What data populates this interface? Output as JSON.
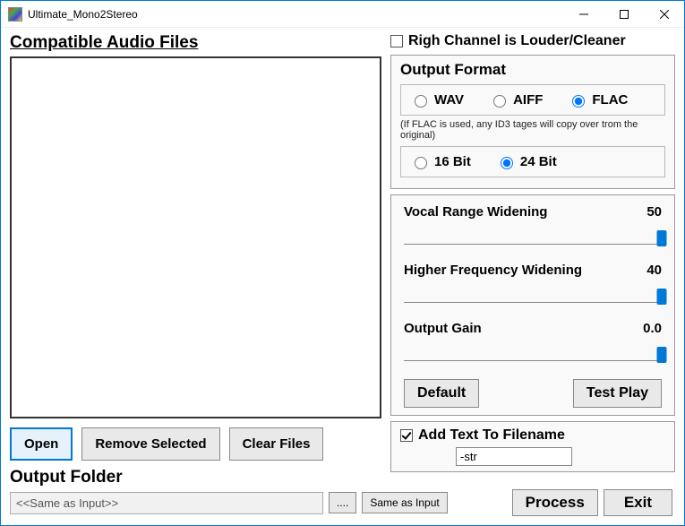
{
  "window": {
    "title": "Ultimate_Mono2Stereo"
  },
  "left": {
    "heading": "Compatible Audio Files",
    "open_btn": "Open",
    "remove_btn": "Remove Selected",
    "clear_btn": "Clear Files",
    "output_folder_label": "Output Folder",
    "output_folder_value": "<<Same as Input>>",
    "browse_btn": "....",
    "same_as_input_btn": "Same as Input"
  },
  "right": {
    "right_channel_label": "Righ Channel is Louder/Cleaner",
    "right_channel_checked": false,
    "output_format_title": "Output Format",
    "fmt_wav": "WAV",
    "fmt_aiff": "AIFF",
    "fmt_flac": "FLAC",
    "fmt_selected": "FLAC",
    "flac_note": "(If FLAC is used, any ID3 tages will copy over trom the original)",
    "bit_16": "16 Bit",
    "bit_24": "24 Bit",
    "bit_selected": "24 Bit",
    "vocal_label": "Vocal Range Widening",
    "vocal_value": "50",
    "vocal_pct": 100,
    "hf_label": "Higher Frequency Widening",
    "hf_value": "40",
    "hf_pct": 100,
    "gain_label": "Output Gain",
    "gain_value": "0.0",
    "gain_pct": 100,
    "default_btn": "Default",
    "testplay_btn": "Test Play",
    "add_text_label": "Add Text To Filename",
    "add_text_checked": true,
    "add_text_value": "-str",
    "process_btn": "Process",
    "exit_btn": "Exit"
  }
}
